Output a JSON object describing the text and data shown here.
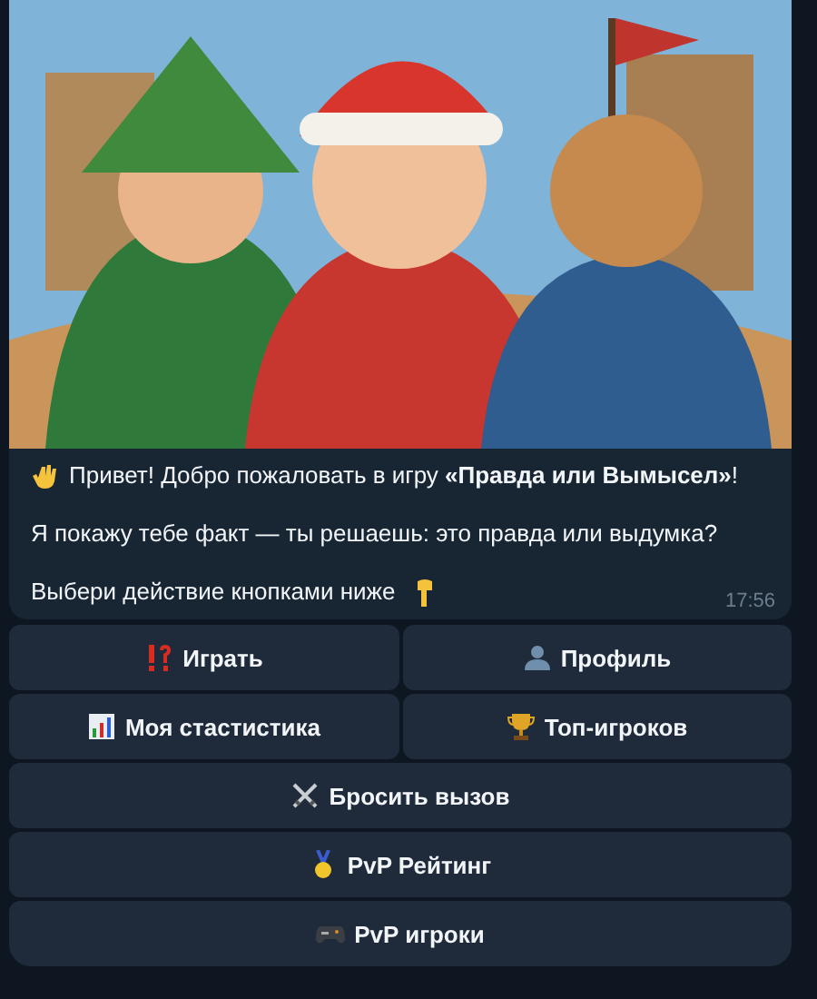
{
  "message": {
    "paragraphs": [
      "Привет! Добро пожаловать в игру **«Правда или Вымысел»**!",
      "Я покажу тебе факт — ты решаешь: это правда или выдумка?",
      "Выбери действие кнопками ниже"
    ],
    "time": "17:56"
  },
  "keyboard": [
    [
      "Играть",
      "Профиль"
    ],
    [
      "Моя стастистика",
      "Топ-игроков"
    ],
    [
      "Бросить вызов"
    ],
    [
      "PvP Рейтинг"
    ],
    [
      "PvP игроки"
    ]
  ]
}
